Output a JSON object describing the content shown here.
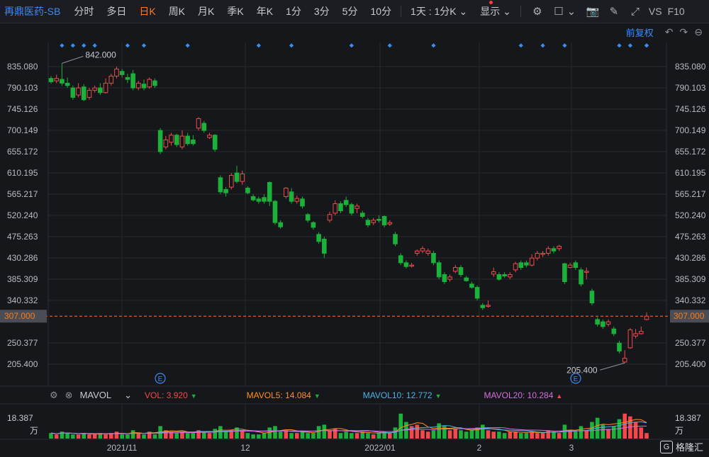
{
  "toolbar": {
    "title": "再鼎医药-SB",
    "periods": [
      "分时",
      "多日",
      "日K",
      "周K",
      "月K",
      "季K",
      "年K",
      "1分",
      "3分",
      "5分",
      "10分"
    ],
    "active_period": "日K",
    "range_select": "1天 : 1分K",
    "display_label": "显示",
    "vs_label": "VS",
    "f10_label": "F10"
  },
  "subbar": {
    "adjust_label": "前复权"
  },
  "price_axis": {
    "ticks": [
      "835.080",
      "790.103",
      "745.126",
      "700.149",
      "655.172",
      "610.195",
      "565.217",
      "520.240",
      "475.263",
      "430.286",
      "385.309",
      "340.332",
      "250.377",
      "205.400"
    ],
    "current_price": "307.000"
  },
  "annotations": {
    "high": "842.000",
    "low": "205.400",
    "event_marker": "E"
  },
  "volume_legend": {
    "indicator": "MAVOL",
    "vol": "VOL: 3.920",
    "mavol5": "MAVOL5: 14.084",
    "mavol10": "MAVOL10: 12.772",
    "mavol20": "MAVOL20: 10.284",
    "vol_axis_top": "18.387",
    "vol_axis_unit": "万"
  },
  "time_axis": [
    "2021/11",
    "12",
    "2022/01",
    "2",
    "3"
  ],
  "colors": {
    "up": "#f2494a",
    "down": "#1bb13a",
    "accent": "#ff7a1a",
    "link": "#3d8cf0"
  },
  "logo": {
    "text": "格隆汇"
  },
  "chart_data": {
    "type": "candlestick",
    "y_range": [
      205.4,
      835.08
    ],
    "candles": [
      [
        810,
        803,
        815,
        799
      ],
      [
        805,
        810,
        818,
        800
      ],
      [
        808,
        800,
        842,
        795
      ],
      [
        800,
        795,
        812,
        790
      ],
      [
        790,
        770,
        795,
        765
      ],
      [
        775,
        790,
        800,
        770
      ],
      [
        792,
        765,
        798,
        762
      ],
      [
        770,
        785,
        790,
        765
      ],
      [
        785,
        790,
        795,
        780
      ],
      [
        790,
        780,
        800,
        775
      ],
      [
        780,
        800,
        810,
        778
      ],
      [
        800,
        815,
        820,
        795
      ],
      [
        815,
        830,
        835,
        810
      ],
      [
        825,
        818,
        830,
        812
      ],
      [
        812,
        808,
        820,
        800
      ],
      [
        820,
        790,
        828,
        785
      ],
      [
        790,
        800,
        805,
        785
      ],
      [
        798,
        790,
        808,
        785
      ],
      [
        792,
        808,
        812,
        788
      ],
      [
        805,
        795,
        810,
        790
      ],
      [
        700,
        655,
        705,
        650
      ],
      [
        665,
        680,
        688,
        660
      ],
      [
        675,
        690,
        695,
        668
      ],
      [
        690,
        670,
        693,
        665
      ],
      [
        665,
        688,
        700,
        660
      ],
      [
        688,
        672,
        695,
        668
      ],
      [
        680,
        672,
        690,
        668
      ],
      [
        705,
        725,
        728,
        700
      ],
      [
        715,
        700,
        720,
        695
      ],
      [
        685,
        690,
        695,
        682
      ],
      [
        690,
        660,
        692,
        655
      ],
      [
        600,
        570,
        605,
        565
      ],
      [
        575,
        568,
        580,
        560
      ],
      [
        580,
        605,
        610,
        575
      ],
      [
        610,
        592,
        625,
        588
      ],
      [
        592,
        608,
        615,
        585
      ],
      [
        578,
        568,
        582,
        565
      ],
      [
        560,
        553,
        565,
        550
      ],
      [
        555,
        550,
        560,
        545
      ],
      [
        558,
        550,
        565,
        545
      ],
      [
        590,
        550,
        592,
        540
      ],
      [
        550,
        505,
        553,
        500
      ],
      [
        505,
        496,
        510,
        492
      ],
      [
        560,
        578,
        580,
        556
      ],
      [
        570,
        550,
        578,
        545
      ],
      [
        550,
        556,
        562,
        545
      ],
      [
        555,
        540,
        560,
        535
      ],
      [
        522,
        510,
        525,
        505
      ],
      [
        505,
        495,
        508,
        490
      ],
      [
        480,
        465,
        485,
        460
      ],
      [
        470,
        440,
        475,
        430
      ],
      [
        510,
        522,
        528,
        505
      ],
      [
        525,
        545,
        552,
        520
      ],
      [
        545,
        530,
        550,
        525
      ],
      [
        552,
        543,
        560,
        538
      ],
      [
        543,
        525,
        547,
        520
      ],
      [
        535,
        540,
        545,
        525
      ],
      [
        525,
        518,
        530,
        514
      ],
      [
        510,
        500,
        515,
        495
      ],
      [
        505,
        510,
        515,
        500
      ],
      [
        512,
        510,
        520,
        505
      ],
      [
        518,
        500,
        520,
        495
      ],
      [
        502,
        505,
        510,
        498
      ],
      [
        480,
        460,
        485,
        455
      ],
      [
        435,
        420,
        440,
        415
      ],
      [
        420,
        412,
        425,
        408
      ],
      [
        415,
        415,
        420,
        410
      ],
      [
        440,
        445,
        448,
        435
      ],
      [
        445,
        450,
        455,
        440
      ],
      [
        440,
        445,
        450,
        435
      ],
      [
        440,
        420,
        445,
        415
      ],
      [
        420,
        390,
        425,
        385
      ],
      [
        395,
        380,
        400,
        375
      ],
      [
        385,
        390,
        395,
        380
      ],
      [
        402,
        410,
        415,
        398
      ],
      [
        410,
        395,
        415,
        390
      ],
      [
        388,
        382,
        392,
        380
      ],
      [
        375,
        368,
        380,
        365
      ],
      [
        368,
        345,
        372,
        340
      ],
      [
        330,
        325,
        335,
        320
      ],
      [
        330,
        330,
        340,
        325
      ],
      [
        396,
        401,
        410,
        390
      ],
      [
        395,
        385,
        400,
        382
      ],
      [
        395,
        392,
        400,
        388
      ],
      [
        390,
        395,
        400,
        385
      ],
      [
        405,
        418,
        422,
        400
      ],
      [
        420,
        410,
        425,
        405
      ],
      [
        420,
        415,
        425,
        410
      ],
      [
        415,
        430,
        438,
        412
      ],
      [
        430,
        440,
        445,
        425
      ],
      [
        438,
        440,
        445,
        432
      ],
      [
        440,
        450,
        455,
        435
      ],
      [
        450,
        445,
        455,
        440
      ],
      [
        450,
        455,
        458,
        445
      ],
      [
        418,
        380,
        420,
        375
      ],
      [
        410,
        415,
        420,
        408
      ],
      [
        420,
        410,
        425,
        405
      ],
      [
        405,
        375,
        410,
        370
      ],
      [
        400,
        402,
        410,
        385
      ],
      [
        360,
        335,
        365,
        330
      ],
      [
        300,
        290,
        305,
        285
      ],
      [
        295,
        285,
        300,
        280
      ],
      [
        290,
        295,
        300,
        285
      ],
      [
        280,
        270,
        285,
        265
      ],
      [
        250,
        233,
        255,
        228
      ],
      [
        210,
        218,
        235,
        208
      ],
      [
        240,
        278,
        282,
        238
      ],
      [
        265,
        270,
        280,
        260
      ],
      [
        270,
        275,
        285,
        268
      ],
      [
        300,
        307,
        315,
        298
      ]
    ],
    "volume": [
      4,
      3,
      5,
      4,
      3,
      3,
      4,
      3,
      3,
      4,
      3,
      4,
      5,
      3,
      3,
      6,
      4,
      3,
      5,
      3,
      9,
      6,
      5,
      4,
      5,
      4,
      4,
      6,
      5,
      4,
      7,
      9,
      5,
      6,
      8,
      6,
      4,
      3,
      3,
      4,
      8,
      9,
      5,
      6,
      4,
      4,
      5,
      4,
      4,
      9,
      10,
      6,
      7,
      4,
      5,
      4,
      4,
      5,
      4,
      3,
      4,
      5,
      4,
      8,
      18,
      12,
      9,
      10,
      6,
      5,
      6,
      11,
      9,
      6,
      7,
      6,
      5,
      6,
      8,
      10,
      6,
      5,
      5,
      4,
      5,
      5,
      4,
      4,
      5,
      4,
      4,
      6,
      5,
      4,
      10,
      6,
      5,
      9,
      6,
      12,
      15,
      10,
      7,
      9,
      14,
      18,
      16,
      12,
      8,
      4
    ]
  }
}
